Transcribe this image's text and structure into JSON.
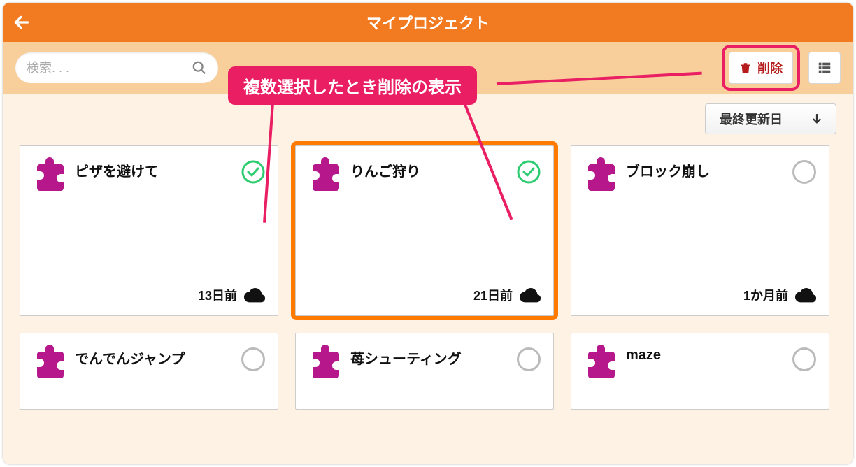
{
  "header": {
    "title": "マイプロジェクト"
  },
  "toolbar": {
    "search_placeholder": "検索. . .",
    "delete_label": "削除"
  },
  "sort": {
    "label": "最終更新日"
  },
  "annotation": {
    "text": "複数選択したとき削除の表示"
  },
  "projects": [
    {
      "title": "ピザを避けて",
      "age": "13日前",
      "selected": true,
      "framed": false
    },
    {
      "title": "りんご狩り",
      "age": "21日前",
      "selected": true,
      "framed": true
    },
    {
      "title": "ブロック崩し",
      "age": "1か月前",
      "selected": false,
      "framed": false
    },
    {
      "title": "でんでんジャンプ",
      "age": "",
      "selected": false,
      "framed": false
    },
    {
      "title": "苺シューティング",
      "age": "",
      "selected": false,
      "framed": false
    },
    {
      "title": "maze",
      "age": "",
      "selected": false,
      "framed": false
    }
  ],
  "colors": {
    "accent": "#f27a21",
    "highlight": "#e91e63",
    "puzzle": "#b6178a",
    "check": "#2ecc71"
  }
}
